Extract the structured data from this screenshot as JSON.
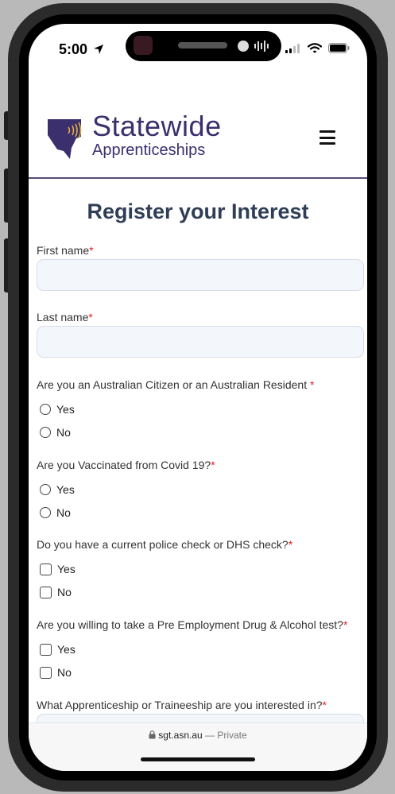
{
  "status_bar": {
    "time": "5:00"
  },
  "header": {
    "brand_line1": "Statewide",
    "brand_line2": "Apprenticeships"
  },
  "form": {
    "title": "Register your Interest",
    "required_mark": "*",
    "first_name_label": "First name",
    "last_name_label": "Last name",
    "q_citizen": "Are you an Australian Citizen or an Australian Resident ",
    "q_vaccinated": "Are you Vaccinated from Covid 19?",
    "q_police": "Do you have a current police check or DHS check?",
    "q_drug": "Are you willing to take a Pre Employment Drug & Alcohol test?",
    "q_apprenticeship": "What Apprenticeship or Traineeship are you interested in?",
    "yes": "Yes",
    "no": "No"
  },
  "browser": {
    "url": "sgt.asn.au",
    "separator": " — ",
    "mode": "Private"
  },
  "colors": {
    "brand": "#3b2f6e",
    "title": "#2f3e56",
    "required": "#e02020",
    "input_bg": "#f3f6fb"
  }
}
